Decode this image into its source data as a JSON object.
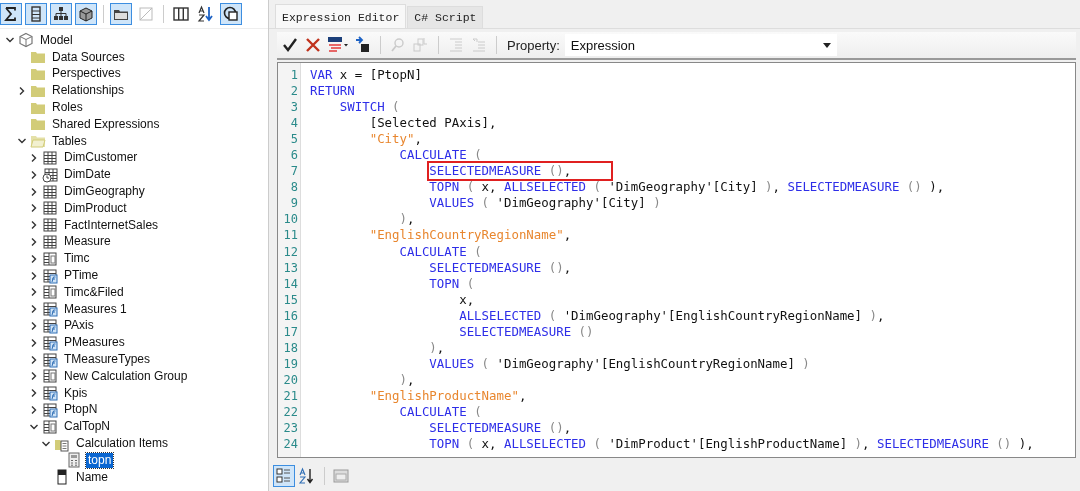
{
  "model_toolbar": [
    {
      "kind": "sigma",
      "pressed": true
    },
    {
      "kind": "column",
      "pressed": true
    },
    {
      "kind": "hierarchy",
      "pressed": true
    },
    {
      "kind": "cube",
      "pressed": true
    },
    {
      "kind": "folder",
      "pressed": true
    },
    {
      "kind": "diagonal",
      "pressed": false
    },
    {
      "kind": "columns",
      "pressed": false
    },
    {
      "kind": "sort",
      "pressed": false
    },
    {
      "kind": "overlap",
      "pressed": true
    }
  ],
  "tree": [
    {
      "label": "Model",
      "kind": "model",
      "expanded": true,
      "selected": false,
      "children": [
        {
          "label": "Data Sources",
          "kind": "folder",
          "selected": false
        },
        {
          "label": "Perspectives",
          "kind": "folder",
          "selected": false
        },
        {
          "label": "Relationships",
          "kind": "folder",
          "expanded": false,
          "selected": false
        },
        {
          "label": "Roles",
          "kind": "folder",
          "selected": false
        },
        {
          "label": "Shared Expressions",
          "kind": "folder",
          "selected": false
        },
        {
          "label": "Tables",
          "kind": "open-folder",
          "expanded": true,
          "selected": false,
          "children": [
            {
              "label": "DimCustomer",
              "kind": "table",
              "expanded": false,
              "selected": false
            },
            {
              "label": "DimDate",
              "kind": "date-table",
              "expanded": false,
              "selected": false
            },
            {
              "label": "DimGeography",
              "kind": "table",
              "expanded": false,
              "selected": false
            },
            {
              "label": "DimProduct",
              "kind": "table",
              "expanded": false,
              "selected": false
            },
            {
              "label": "FactInternetSales",
              "kind": "table",
              "expanded": false,
              "selected": false
            },
            {
              "label": "Measure",
              "kind": "table",
              "expanded": false,
              "selected": false
            },
            {
              "label": "Timc",
              "kind": "calc-table",
              "expanded": false,
              "selected": false
            },
            {
              "label": "PTime",
              "kind": "param-table",
              "expanded": false,
              "selected": false
            },
            {
              "label": "Timc&Filed",
              "kind": "calc-table",
              "expanded": false,
              "selected": false
            },
            {
              "label": "Measures 1",
              "kind": "param-table",
              "expanded": false,
              "selected": false
            },
            {
              "label": "PAxis",
              "kind": "param-table",
              "expanded": false,
              "selected": false
            },
            {
              "label": "PMeasures",
              "kind": "param-table",
              "expanded": false,
              "selected": false
            },
            {
              "label": "TMeasureTypes",
              "kind": "param-table",
              "expanded": false,
              "selected": false
            },
            {
              "label": "New Calculation Group",
              "kind": "calc-table",
              "expanded": false,
              "selected": false
            },
            {
              "label": "Kpis",
              "kind": "param-table",
              "expanded": false,
              "selected": false
            },
            {
              "label": "PtopN",
              "kind": "param-table",
              "expanded": false,
              "selected": false
            },
            {
              "label": "CalTopN",
              "kind": "calc-table",
              "expanded": true,
              "selected": false,
              "children": [
                {
                  "label": "Calculation Items",
                  "kind": "calc-folder",
                  "expanded": true,
                  "selected": false,
                  "children": [
                    {
                      "label": "topn",
                      "kind": "calc-item",
                      "selected": true
                    }
                  ]
                },
                {
                  "label": "Name",
                  "kind": "column",
                  "selected": false
                }
              ]
            }
          ]
        }
      ]
    }
  ],
  "tabs": [
    {
      "label": "Expression Editor",
      "selected": true
    },
    {
      "label": "C# Script",
      "selected": false
    }
  ],
  "editor_toolbar": [
    {
      "items": [
        {
          "kind": "check",
          "disabled": false
        },
        {
          "kind": "cross",
          "disabled": false
        },
        {
          "kind": "dax-format",
          "disabled": false
        },
        {
          "kind": "deploy",
          "disabled": false
        }
      ]
    },
    {
      "items": [
        {
          "kind": "find",
          "disabled": true
        },
        {
          "kind": "replace",
          "disabled": true
        }
      ]
    },
    {
      "items": [
        {
          "kind": "indent",
          "disabled": true
        },
        {
          "kind": "outdent",
          "disabled": true
        }
      ]
    }
  ],
  "property": {
    "label": "Property:",
    "value": "Expression"
  },
  "code_lines": [
    {
      "number": "1",
      "boxed": false,
      "tokens": [
        {
          "kind": "keyword",
          "text": "VAR"
        },
        {
          "kind": "plain",
          "text": " x = [PtopN]"
        }
      ]
    },
    {
      "number": "2",
      "boxed": false,
      "tokens": [
        {
          "kind": "keyword",
          "text": "RETURN"
        }
      ]
    },
    {
      "number": "3",
      "boxed": false,
      "tokens": [
        {
          "kind": "keyword",
          "text": "    SWITCH"
        },
        {
          "kind": "paren",
          "text": " ("
        }
      ]
    },
    {
      "number": "4",
      "boxed": false,
      "tokens": [
        {
          "kind": "plain",
          "text": "        [Selected PAxis],"
        }
      ]
    },
    {
      "number": "5",
      "boxed": false,
      "tokens": [
        {
          "kind": "string",
          "text": "        \"City\""
        },
        {
          "kind": "plain",
          "text": ","
        }
      ]
    },
    {
      "number": "6",
      "boxed": false,
      "tokens": [
        {
          "kind": "keyword",
          "text": "            CALCULATE"
        },
        {
          "kind": "paren",
          "text": " ("
        }
      ]
    },
    {
      "number": "7",
      "boxed": true,
      "tokens": [
        {
          "kind": "keyword",
          "text": "                SELECTEDMEASURE"
        },
        {
          "kind": "paren",
          "text": " ()"
        },
        {
          "kind": "plain",
          "text": ","
        }
      ]
    },
    {
      "number": "8",
      "boxed": false,
      "tokens": [
        {
          "kind": "keyword",
          "text": "                TOPN"
        },
        {
          "kind": "paren",
          "text": " ("
        },
        {
          "kind": "plain",
          "text": " x, "
        },
        {
          "kind": "keyword",
          "text": "ALLSELECTED"
        },
        {
          "kind": "paren",
          "text": " ("
        },
        {
          "kind": "plain",
          "text": " 'DimGeography'[City] "
        },
        {
          "kind": "paren",
          "text": ")"
        },
        {
          "kind": "plain",
          "text": ", "
        },
        {
          "kind": "keyword",
          "text": "SELECTEDMEASURE"
        },
        {
          "kind": "paren",
          "text": " ()"
        },
        {
          "kind": "plain",
          "text": " ),"
        }
      ]
    },
    {
      "number": "9",
      "boxed": false,
      "tokens": [
        {
          "kind": "keyword",
          "text": "                VALUES"
        },
        {
          "kind": "paren",
          "text": " ("
        },
        {
          "kind": "plain",
          "text": " 'DimGeography'[City] "
        },
        {
          "kind": "paren",
          "text": ")"
        }
      ]
    },
    {
      "number": "10",
      "boxed": false,
      "tokens": [
        {
          "kind": "paren",
          "text": "            )"
        },
        {
          "kind": "plain",
          "text": ","
        }
      ]
    },
    {
      "number": "11",
      "boxed": false,
      "tokens": [
        {
          "kind": "string",
          "text": "        \"EnglishCountryRegionName\""
        },
        {
          "kind": "plain",
          "text": ","
        }
      ]
    },
    {
      "number": "12",
      "boxed": false,
      "tokens": [
        {
          "kind": "keyword",
          "text": "            CALCULATE"
        },
        {
          "kind": "paren",
          "text": " ("
        }
      ]
    },
    {
      "number": "13",
      "boxed": false,
      "tokens": [
        {
          "kind": "keyword",
          "text": "                SELECTEDMEASURE"
        },
        {
          "kind": "paren",
          "text": " ()"
        },
        {
          "kind": "plain",
          "text": ","
        }
      ]
    },
    {
      "number": "14",
      "boxed": false,
      "tokens": [
        {
          "kind": "keyword",
          "text": "                TOPN"
        },
        {
          "kind": "paren",
          "text": " ("
        }
      ]
    },
    {
      "number": "15",
      "boxed": false,
      "tokens": [
        {
          "kind": "plain",
          "text": "                    x,"
        }
      ]
    },
    {
      "number": "16",
      "boxed": false,
      "tokens": [
        {
          "kind": "keyword",
          "text": "                    ALLSELECTED"
        },
        {
          "kind": "paren",
          "text": " ("
        },
        {
          "kind": "plain",
          "text": " 'DimGeography'[EnglishCountryRegionName] "
        },
        {
          "kind": "paren",
          "text": ")"
        },
        {
          "kind": "plain",
          "text": ","
        }
      ]
    },
    {
      "number": "17",
      "boxed": false,
      "tokens": [
        {
          "kind": "keyword",
          "text": "                    SELECTEDMEASURE"
        },
        {
          "kind": "paren",
          "text": " ()"
        }
      ]
    },
    {
      "number": "18",
      "boxed": false,
      "tokens": [
        {
          "kind": "paren",
          "text": "                )"
        },
        {
          "kind": "plain",
          "text": ","
        }
      ]
    },
    {
      "number": "19",
      "boxed": false,
      "tokens": [
        {
          "kind": "keyword",
          "text": "                VALUES"
        },
        {
          "kind": "paren",
          "text": " ("
        },
        {
          "kind": "plain",
          "text": " 'DimGeography'[EnglishCountryRegionName] "
        },
        {
          "kind": "paren",
          "text": ")"
        }
      ]
    },
    {
      "number": "20",
      "boxed": false,
      "tokens": [
        {
          "kind": "paren",
          "text": "            )"
        },
        {
          "kind": "plain",
          "text": ","
        }
      ]
    },
    {
      "number": "21",
      "boxed": false,
      "tokens": [
        {
          "kind": "string",
          "text": "        \"EnglishProductName\""
        },
        {
          "kind": "plain",
          "text": ","
        }
      ]
    },
    {
      "number": "22",
      "boxed": false,
      "tokens": [
        {
          "kind": "keyword",
          "text": "            CALCULATE"
        },
        {
          "kind": "paren",
          "text": " ("
        }
      ]
    },
    {
      "number": "23",
      "boxed": false,
      "tokens": [
        {
          "kind": "keyword",
          "text": "                SELECTEDMEASURE"
        },
        {
          "kind": "paren",
          "text": " ()"
        },
        {
          "kind": "plain",
          "text": ","
        }
      ]
    },
    {
      "number": "24",
      "boxed": false,
      "tokens": [
        {
          "kind": "keyword",
          "text": "                TOPN"
        },
        {
          "kind": "paren",
          "text": " ("
        },
        {
          "kind": "plain",
          "text": " x, "
        },
        {
          "kind": "keyword",
          "text": "ALLSELECTED"
        },
        {
          "kind": "paren",
          "text": " ("
        },
        {
          "kind": "plain",
          "text": " 'DimProduct'[EnglishProductName] "
        },
        {
          "kind": "paren",
          "text": ")"
        },
        {
          "kind": "plain",
          "text": ", "
        },
        {
          "kind": "keyword",
          "text": "SELECTEDMEASURE"
        },
        {
          "kind": "paren",
          "text": " ()"
        },
        {
          "kind": "plain",
          "text": " ),"
        }
      ]
    }
  ],
  "bottom_toolbar": [
    {
      "items": [
        {
          "kind": "categorized",
          "pressed": true
        },
        {
          "kind": "alphabetical",
          "pressed": false
        }
      ]
    },
    {
      "items": [
        {
          "kind": "property-pages",
          "pressed": false
        }
      ]
    }
  ]
}
